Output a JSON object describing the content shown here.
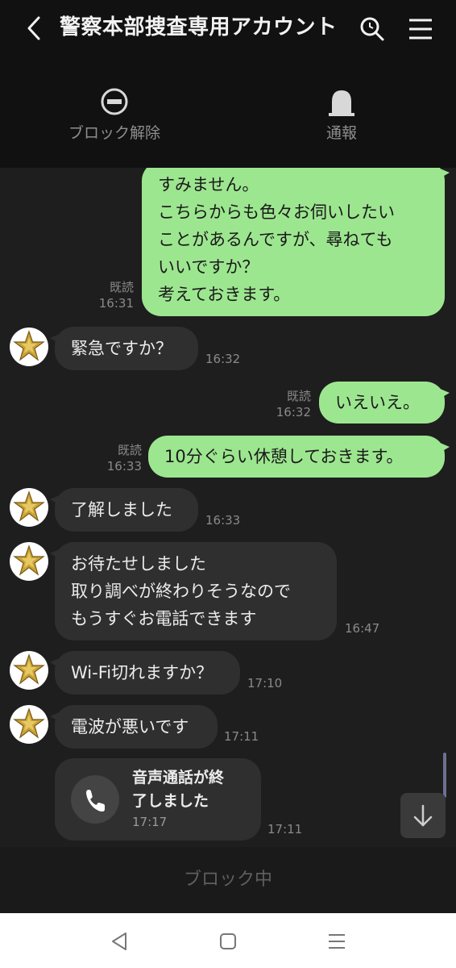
{
  "header": {
    "title": "警察本部捜査専用アカウント",
    "actions": [
      {
        "label": "ブロック解除",
        "icon": "unblock-icon"
      },
      {
        "label": "通報",
        "icon": "report-icon"
      }
    ]
  },
  "messages": [
    {
      "from": "me",
      "lines": [
        "すみません。",
        "こちらからも色々お伺いしたい",
        "ことがあるんですが、尋ねても",
        "いいですか？",
        "考えておきます。"
      ],
      "read": "既読",
      "time": "16:31"
    },
    {
      "from": "them",
      "lines": [
        "緊急ですか？"
      ],
      "time": "16:32"
    },
    {
      "from": "me",
      "lines": [
        "いえいえ。"
      ],
      "read": "既読",
      "time": "16:32"
    },
    {
      "from": "me",
      "lines": [
        "10分ぐらい休憩しておきます。"
      ],
      "read": "既読",
      "time": "16:33"
    },
    {
      "from": "them",
      "lines": [
        "了解しました"
      ],
      "time": "16:33"
    },
    {
      "from": "them",
      "lines": [
        "お待たせしました",
        "取り調べが終わりそうなので",
        "もうすぐお電話できます"
      ],
      "time": "16:47"
    },
    {
      "from": "them",
      "lines": [
        "Wi-Fi切れますか？"
      ],
      "time": "17:10"
    },
    {
      "from": "them",
      "lines": [
        "電波が悪いです"
      ],
      "time": "17:11"
    }
  ],
  "call": {
    "title_lines": [
      "音声通話が終",
      "了しました"
    ],
    "duration": "17:17",
    "time": "17:11"
  },
  "footer": {
    "status": "ブロック中"
  },
  "colors": {
    "my_bubble": "#9de690",
    "their_bubble": "#2f2f2f",
    "background": "#1e1e1e",
    "header": "#111111"
  }
}
